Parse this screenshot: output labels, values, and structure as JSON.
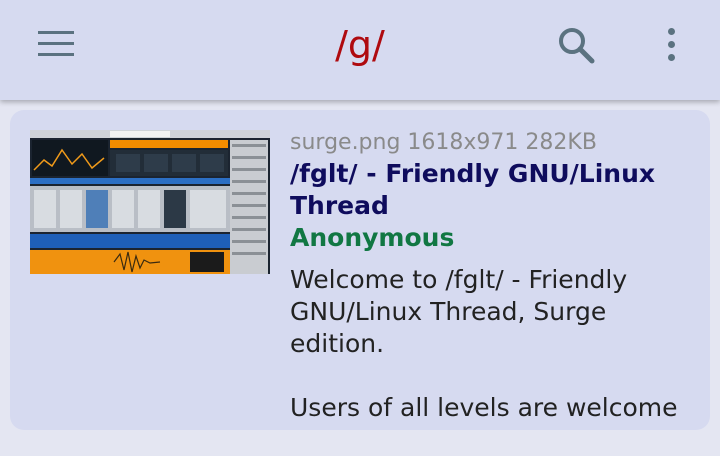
{
  "appbar": {
    "title": "/g/",
    "menu_icon": "hamburger-menu-icon",
    "search_icon": "search-icon",
    "more_icon": "more-vert-icon"
  },
  "post": {
    "file_info": "surge.png 1618x971 282KB",
    "subject": "/fglt/ - Friendly GNU/Linux Thread",
    "name": "Anonymous",
    "comment_lines": [
      "Welcome to /fglt/ - Friendly GNU/Linux Thread, Surge edition.",
      "Users of all levels are welcome"
    ]
  },
  "colors": {
    "board_title": "#af0a0f",
    "subject": "#0f0c5d",
    "name": "#117743",
    "card_bg": "#d6daf0",
    "page_bg": "#e4e6f2"
  }
}
